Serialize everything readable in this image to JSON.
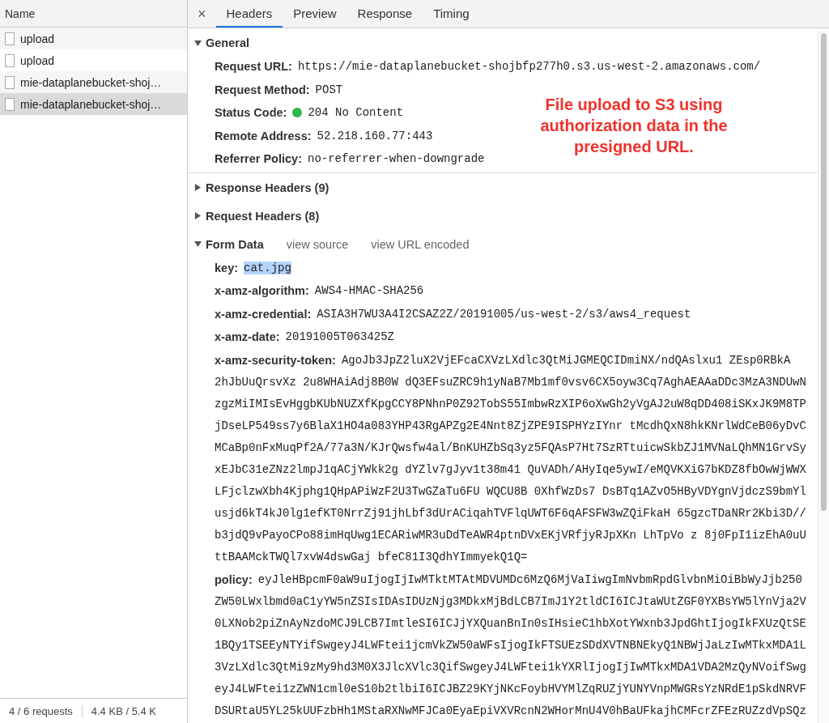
{
  "sidebar": {
    "header": "Name",
    "items": [
      {
        "name": "upload",
        "selected": false
      },
      {
        "name": "upload",
        "selected": false
      },
      {
        "name": "mie-dataplanebucket-shoj…",
        "selected": false
      },
      {
        "name": "mie-dataplanebucket-shoj…",
        "selected": true
      }
    ]
  },
  "status_bar": [
    "4 / 6 requests",
    "4.4 KB / 5.4 K"
  ],
  "tabs": {
    "close": "×",
    "items": [
      {
        "label": "Headers",
        "selected": true
      },
      {
        "label": "Preview",
        "selected": false
      },
      {
        "label": "Response",
        "selected": false
      },
      {
        "label": "Timing",
        "selected": false
      }
    ]
  },
  "sections": [
    {
      "title": "General",
      "expanded": true,
      "fields": [
        {
          "label": "Request URL:",
          "lines": [
            "https://mie-dataplanebucket-shojbfp277h0.s3.us-west-2.amazonaws.com/"
          ],
          "kind": "text"
        },
        {
          "label": "Request Method:",
          "lines": [
            "POST"
          ],
          "kind": "text"
        },
        {
          "label": "Status Code:",
          "lines": [
            "204 No Content"
          ],
          "kind": "status"
        },
        {
          "label": "Remote Address:",
          "lines": [
            "52.218.160.77:443"
          ],
          "kind": "text"
        },
        {
          "label": "Referrer Policy:",
          "lines": [
            "no-referrer-when-downgrade"
          ],
          "kind": "text"
        }
      ]
    },
    {
      "title": "Response Headers (9)",
      "expanded": false
    },
    {
      "title": "Request Headers (8)",
      "expanded": false
    },
    {
      "title": "Form Data",
      "expanded": true,
      "links": [
        "view source",
        "view URL encoded"
      ],
      "fields": [
        {
          "label": "key:",
          "lines": [
            "cat.jpg"
          ],
          "kind": "highlighted"
        },
        {
          "label": "x-amz-algorithm:",
          "lines": [
            "AWS4-HMAC-SHA256"
          ],
          "kind": "text"
        },
        {
          "label": "x-amz-credential:",
          "lines": [
            "ASIA3H7WU3A4I2CSAZ2Z/20191005/us-west-2/s3/aws4_request"
          ],
          "kind": "text"
        },
        {
          "label": "x-amz-date:",
          "lines": [
            "20191005T063425Z"
          ],
          "kind": "text"
        },
        {
          "label": "x-amz-security-token:",
          "kind": "text",
          "lines": [
            "AgoJb3JpZ2luX2VjEFcaCXVzLXdlc3QtMiJGMEQCIDmiNX/ndQAslxu1 ZEsp0RBkA",
            "2hJbUuQrsvXz 2u8WHAiAdj8B0W dQ3EFsuZRC9h1yNaB7Mb1mf0vsv6CX5oyw3Cq7AghAEAAaDDc3MzA3NDUwN",
            "zgzMiIMIsEvHggbKUbNUZXfKpgCCY8PNhnP0Z92TobS55ImbwRzXIP6oXwGh2yVgAJ2uW8qDD408iSKxJK9M8TP",
            "jDseLP549ss7y6BlaX1HO4a083YHP43RgAPZg2E4Nnt8ZjZPE9ISPHYzIYnr tMcdhQxN8hkKNrlWdCeB06yDvC",
            "MCaBp0nFxMuqPf2A/77a3N/KJrQwsfw4al/BnKUHZbSq3yz5FQAsP7Ht7SzRTtuicwSkbZJ1MVNaLQhMN1GrvSy",
            "xEJbC31eZNz2lmpJ1qACjYWkk2g dYZlv7gJyv1t38m41 QuVADh/AHyIqe5ywI/eMQVKXiG7bKDZ8fbOwWjWWX",
            "LFjclzwXbh4Kjphg1QHpAPiWzF2U3TwGZaTu6FU WQCU8B 0XhfWzDs7 DsBTq1AZvO5HByVDYgnVjdczS9bmYl",
            "usjd6kT4kJ0lg1efKT0NrrZj91jhLbf3dUrACiqahTVFlqUWT6F6qAFSFW3wZQiFkaH 65gzcTDaNRr2Kbi3D//",
            "b3jdQ9vPayoCPo88imHqUwg1ECARiwMR3uDdTeAWR4ptnDVxEKjVRfjyRJpXKn LhTpVo z 8j0FpI1izEhA0uU",
            "ttBAAMckTWQl7xvW4dswGaj bfeC81I3QdhYImmyekQ1Q="
          ]
        },
        {
          "label": "policy:",
          "kind": "text",
          "lines": [
            "eyJleHBpcmF0aW9uIjogIjIwMTktMTAtMDVUMDc6MzQ6MjVaIiwgImNvbmRpdGlvbnMiOiBbWyJjb250",
            "ZW50LWxlbmd0aC1yYW5nZSIsIDAsIDUzNjg3MDkxMjBdLCB7ImJ1Y2tldCI6ICJtaWUtZGF0YXBsYW5lYnVja2V",
            "0LXNob2piZnAyNzdoMCJ9LCB7ImtleSI6ICJjYXQuanBnIn0sIHsieC1hbXotYWxnb3JpdGhtIjogIkFXUzQtSE",
            "1BQy1TSEEyNTYifSwgeyJ4LWFtei1jcmVkZW50aWFsIjogIkFTSUEzSDdXVTNBNEkyQ1NBWjJaLzIwMTkxMDA1L",
            "3VzLXdlc3QtMi9zMy9hd3M0X3JlcXVlc3QifSwgeyJ4LWFtei1kYXRlIjogIjIwMTkxMDA1VDA2MzQyNVoifSwg",
            "eyJ4LWFtei1zZWN1cml0eS10b2tlbiI6ICJBZ29KYjNKcFoybHVYMlZqRUZjYUNYVnpMWGRsYzNRdE1pSkdNRVF",
            "DSURtaU5YL25kUUFzbHh1MStaRXNwMFJCa0EyaEpiVXVRcnN2WHorMnU4V0hBaUFkajhCMFcrZFEzRUZzdVpSQz"
          ]
        }
      ]
    }
  ],
  "annotation": "File upload to S3 using authorization data in the presigned URL."
}
